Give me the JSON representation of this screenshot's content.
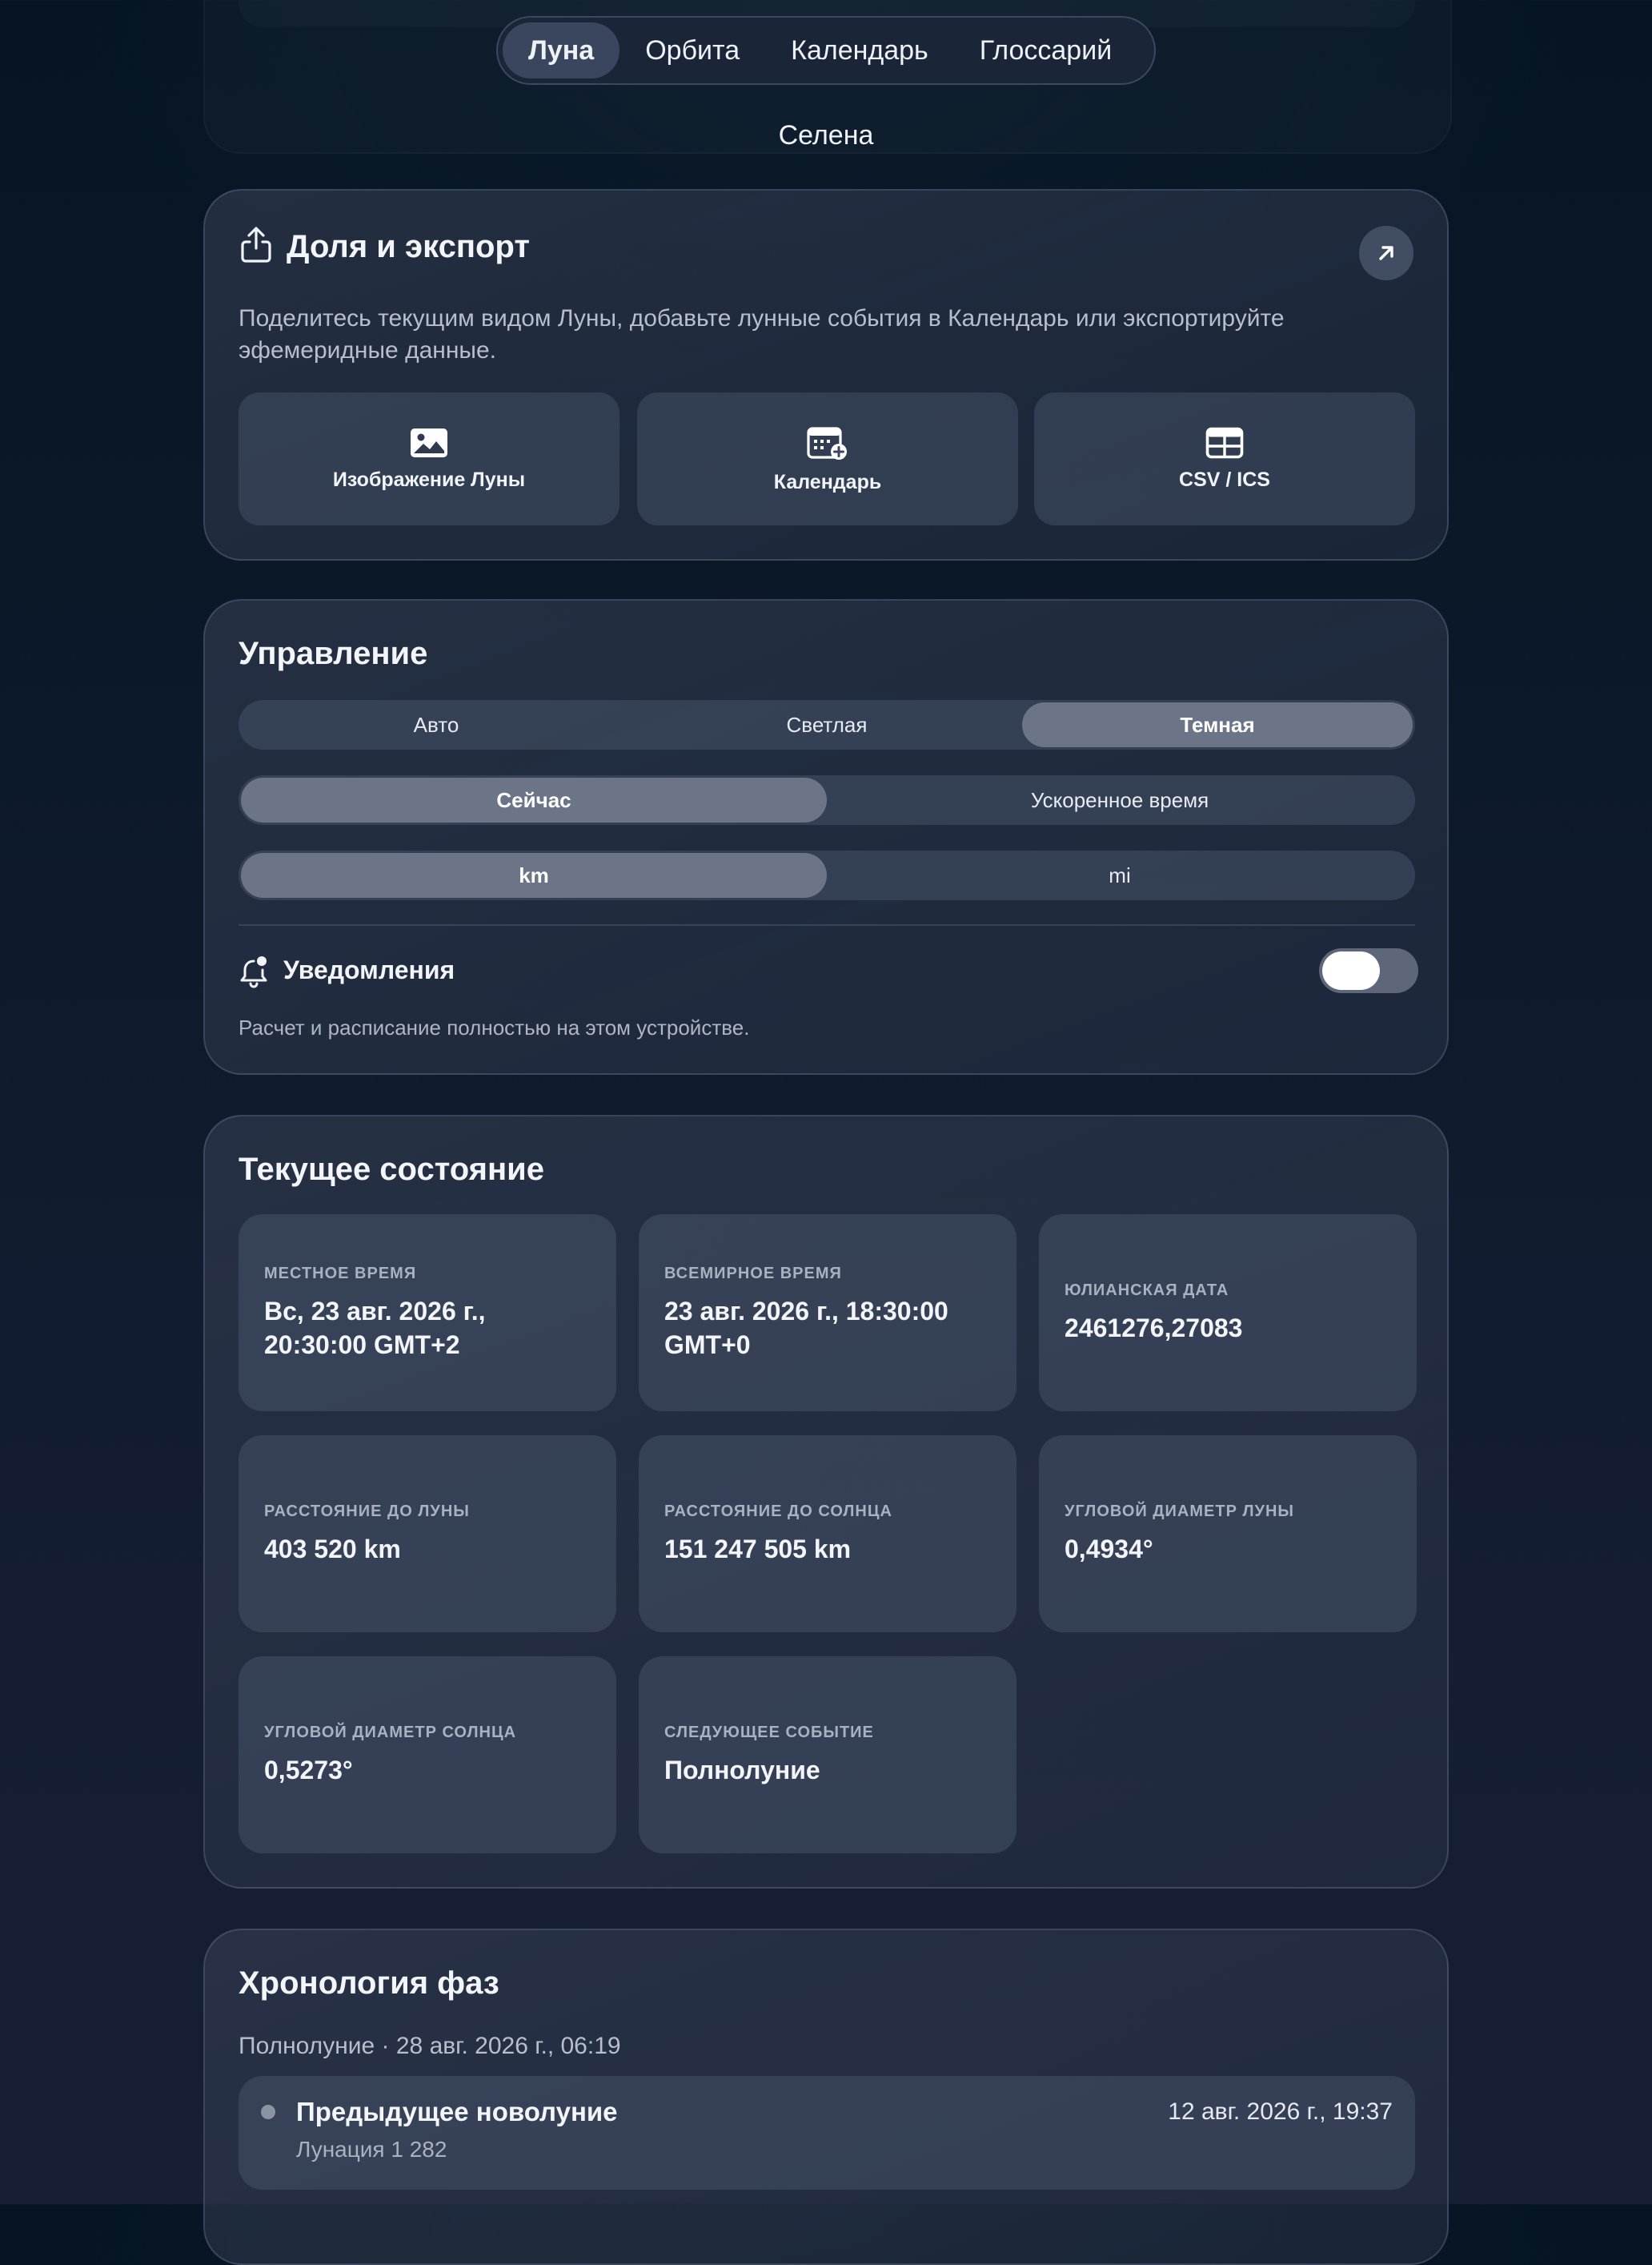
{
  "tabs": [
    {
      "label": "Луна",
      "active": true
    },
    {
      "label": "Орбита",
      "active": false
    },
    {
      "label": "Календарь",
      "active": false
    },
    {
      "label": "Глоссарий",
      "active": false
    }
  ],
  "subtitle": "Селена",
  "share": {
    "title": "Доля и экспорт",
    "description": "Поделитесь текущим видом Луны, добавьте лунные события в Календарь или экспортируйте эфемеридные данные.",
    "buttons": [
      {
        "label": "Изображение Луны",
        "icon": "image-icon"
      },
      {
        "label": "Календарь",
        "icon": "calendar-add-icon"
      },
      {
        "label": "CSV / ICS",
        "icon": "table-icon"
      }
    ]
  },
  "controls": {
    "title": "Управление",
    "theme": {
      "options": [
        "Авто",
        "Светлая",
        "Темная"
      ],
      "selected": "Темная"
    },
    "time_mode": {
      "options": [
        "Сейчас",
        "Ускоренное время"
      ],
      "selected": "Сейчас"
    },
    "units": {
      "options": [
        "km",
        "mi"
      ],
      "selected": "km"
    },
    "notifications_label": "Уведомления",
    "notifications_on": true,
    "note": "Расчет и расписание полностью на этом устройстве."
  },
  "current_state": {
    "title": "Текущее состояние",
    "tiles": [
      {
        "label": "МЕСТНОЕ ВРЕМЯ",
        "value": "Вс, 23 авг. 2026 г., 20:30:00 GMT+2"
      },
      {
        "label": "ВСЕМИРНОЕ ВРЕМЯ",
        "value": "23 авг. 2026 г., 18:30:00 GMT+0"
      },
      {
        "label": "ЮЛИАНСКАЯ ДАТА",
        "value": "2461276,27083"
      },
      {
        "label": "РАССТОЯНИЕ ДО ЛУНЫ",
        "value": "403 520 km"
      },
      {
        "label": "РАССТОЯНИЕ ДО СОЛНЦА",
        "value": "151 247 505 km"
      },
      {
        "label": "УГЛОВОЙ ДИАМЕТР ЛУНЫ",
        "value": "0,4934°"
      },
      {
        "label": "УГЛОВОЙ ДИАМЕТР СОЛНЦА",
        "value": "0,5273°"
      },
      {
        "label": "СЛЕДУЮЩЕЕ СОБЫТИЕ",
        "value": "Полнолуние"
      }
    ]
  },
  "phase_history": {
    "title": "Хронология фаз",
    "subtitle": "Полнолуние · 28 авг. 2026 г., 06:19",
    "events": [
      {
        "name": "Предыдущее новолуние",
        "date": "12 авг. 2026 г., 19:37",
        "detail": "Лунация 1 282"
      }
    ]
  },
  "colors": {
    "background": "#0a1828",
    "card": "#343e52",
    "selected_segment": "#6c7587",
    "active_tab": "#3a465d"
  }
}
